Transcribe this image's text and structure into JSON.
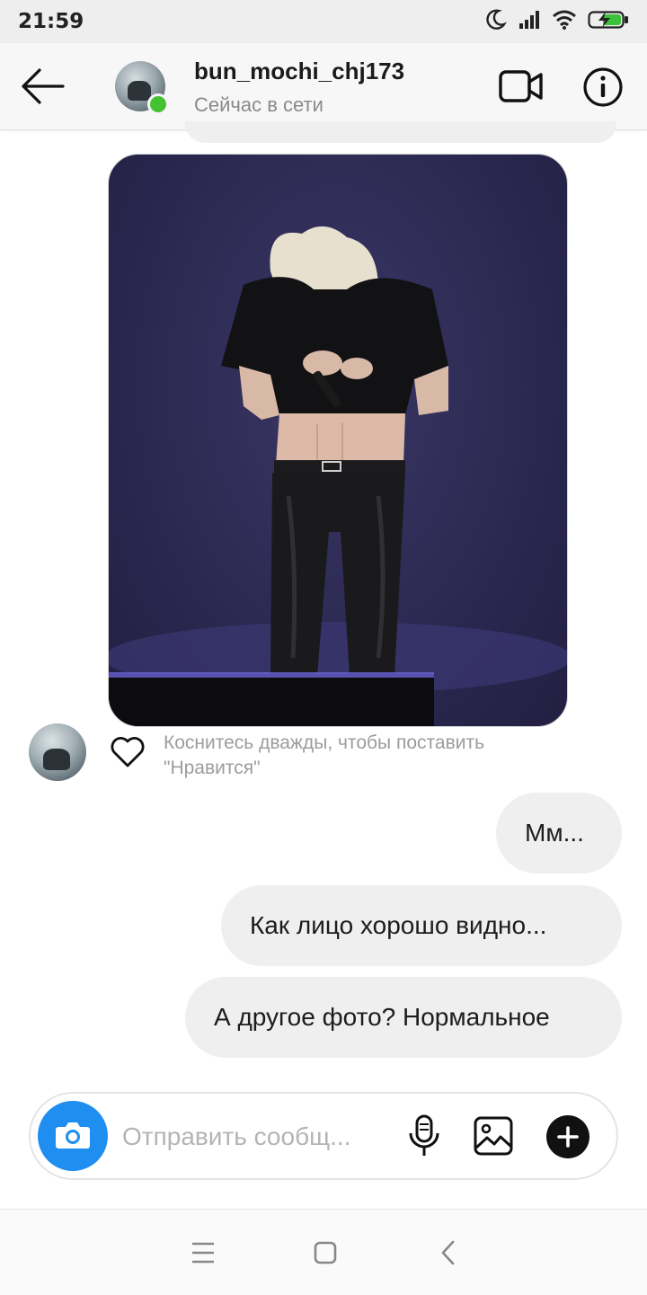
{
  "status_bar": {
    "time": "21:59",
    "icons": [
      "moon-icon",
      "signal-icon",
      "wifi-icon",
      "battery-charging-icon"
    ]
  },
  "header": {
    "username": "bun_mochi_chj173",
    "presence": "Сейчас в сети",
    "online_color": "#44c231",
    "icons": [
      "back-arrow-icon",
      "video-call-icon",
      "info-icon"
    ]
  },
  "chat": {
    "photo_message": {
      "description_icon": "photo-message"
    },
    "like_hint": "Коснитесь дважды, чтобы поставить \"Нравится\"",
    "outgoing_messages": [
      "Мм...",
      "Как лицо хорошо видно...",
      "А другое фото? Нормальное"
    ]
  },
  "composer": {
    "placeholder": "Отправить сообщ...",
    "value": "",
    "accent_color": "#1f8ef1",
    "icons": [
      "camera-icon",
      "microphone-icon",
      "gallery-icon",
      "plus-icon"
    ]
  },
  "nav_bar": {
    "icons": [
      "menu-icon",
      "home-square-icon",
      "back-chevron-icon"
    ]
  }
}
